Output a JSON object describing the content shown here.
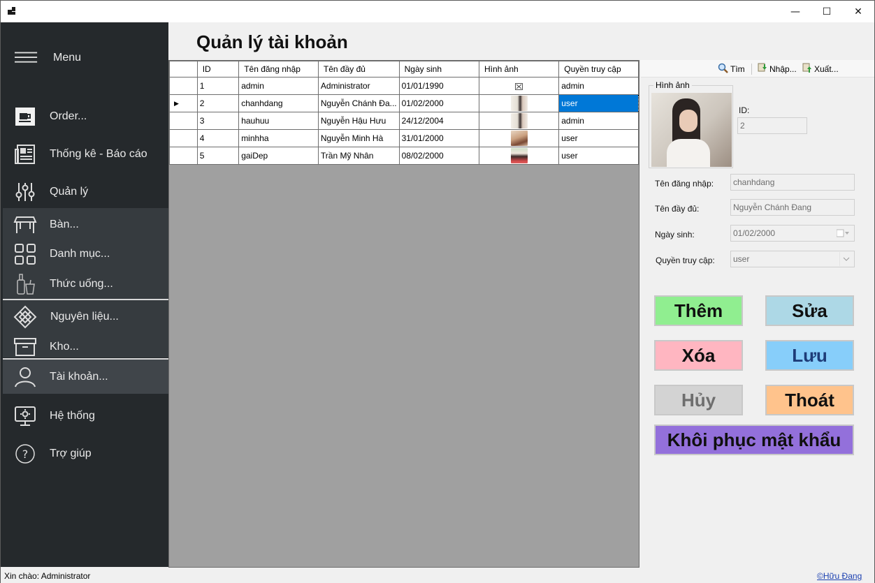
{
  "window": {
    "minimize": "—",
    "maximize": "☐",
    "close": "✕"
  },
  "sidebar": {
    "menu_label": "Menu",
    "items": [
      {
        "label": "Order...",
        "icon": "coffee-cup-icon"
      },
      {
        "label": "Thống kê - Báo cáo",
        "icon": "newspaper-icon"
      },
      {
        "label": "Quản lý",
        "icon": "sliders-icon"
      },
      {
        "label": "Bàn...",
        "icon": "table-icon"
      },
      {
        "label": "Danh mục...",
        "icon": "grid-icon"
      },
      {
        "label": "Thức uống...",
        "icon": "drinks-icon"
      },
      {
        "label": "Nguyên liệu...",
        "icon": "diamond-grid-icon"
      },
      {
        "label": "Kho...",
        "icon": "archive-box-icon"
      },
      {
        "label": "Tài khoản...",
        "icon": "user-icon"
      },
      {
        "label": "Hệ thống",
        "icon": "monitor-gear-icon"
      },
      {
        "label": "Trợ giúp",
        "icon": "help-circle-icon"
      }
    ]
  },
  "main": {
    "title": "Quản lý tài khoản"
  },
  "grid": {
    "columns": [
      "ID",
      "Tên đăng nhập",
      "Tên đầy đủ",
      "Ngày sinh",
      "Hình ảnh",
      "Quyền truy cập"
    ],
    "rows": [
      {
        "id": "1",
        "username": "admin",
        "fullname": "Administrator",
        "dob": "01/01/1990",
        "role": "admin"
      },
      {
        "id": "2",
        "username": "chanhdang",
        "fullname": "Nguyễn Chánh Đa...",
        "dob": "01/02/2000",
        "role": "user"
      },
      {
        "id": "3",
        "username": "hauhuu",
        "fullname": "Nguyễn Hậu Hưu",
        "dob": "24/12/2004",
        "role": "admin"
      },
      {
        "id": "4",
        "username": "minhha",
        "fullname": "Nguyễn Minh Hà",
        "dob": "31/01/2000",
        "role": "user"
      },
      {
        "id": "5",
        "username": "gaiDep",
        "fullname": "Trần Mỹ Nhân",
        "dob": "08/02/2000",
        "role": "user"
      }
    ],
    "selected_row": 2,
    "selected_color": "#0078d7"
  },
  "toolbar": {
    "search": "Tìm",
    "import": "Nhập...",
    "export": "Xuất..."
  },
  "detail": {
    "image_group": "Hình ảnh",
    "id_label": "ID:",
    "id_value": "2",
    "username_label": "Tên đăng nhập:",
    "username_value": "chanhdang",
    "fullname_label": "Tên đầy đủ:",
    "fullname_value": "Nguyễn Chánh Đang",
    "dob_label": "Ngày sinh:",
    "dob_value": "01/02/2000",
    "role_label": "Quyền truy cập:",
    "role_value": "user"
  },
  "buttons": {
    "add": {
      "label": "Thêm",
      "color": "#90ee90"
    },
    "edit": {
      "label": "Sửa",
      "color": "#add8e6"
    },
    "delete": {
      "label": "Xóa",
      "color": "#ffb6c1"
    },
    "save": {
      "label": "Lưu",
      "color": "#87cefa",
      "text_color": "#1e3c78"
    },
    "cancel": {
      "label": "Hủy",
      "color": "#d3d3d3",
      "text_color": "#6e6e6e"
    },
    "exit": {
      "label": "Thoát",
      "color": "#ffc38c"
    },
    "reset_password": {
      "label": "Khôi phục mật khẩu",
      "color": "#9370db"
    }
  },
  "status": {
    "greeting": "Xin chào: Administrator",
    "author_link": "©Hữu Đang"
  }
}
